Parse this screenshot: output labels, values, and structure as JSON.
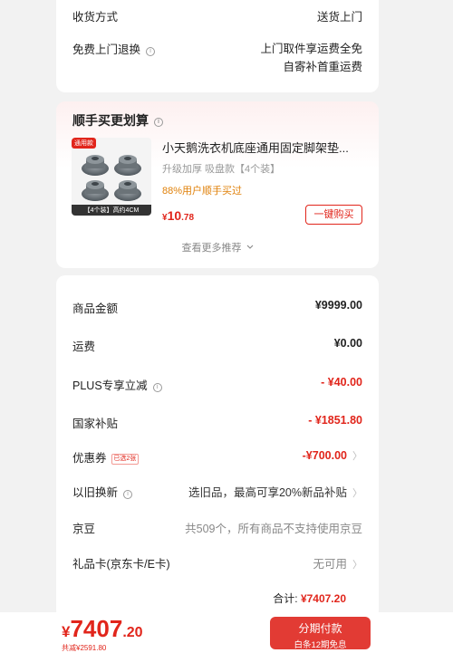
{
  "delivery": {
    "method_label": "收货方式",
    "method_value": "送货上门",
    "return_label": "免费上门退换",
    "return_info_icon": "info-icon",
    "return_value_line1": "上门取件享运费全免",
    "return_value_line2": "自寄补首重运费"
  },
  "recommend": {
    "title": "顺手买更划算",
    "info_icon": "info-icon",
    "product": {
      "badge": "通用款",
      "image_caption": "【4个装】高约4CM",
      "name": "小天鹅洗衣机底座通用固定脚架垫...",
      "spec": "升级加厚 吸盘款【4个装】",
      "buyers": "88%用户顺手买过",
      "price_currency": "¥",
      "price_int": "10",
      "price_dec": ".78",
      "buy_label": "一键购买"
    },
    "more_label": "查看更多推荐",
    "more_icon": "chevron-down-icon"
  },
  "summary": {
    "rows": [
      {
        "label": "商品金额",
        "value": "¥9999.00"
      },
      {
        "label": "运费",
        "value": "¥0.00"
      },
      {
        "label": "PLUS专享立减",
        "value": "- ¥40.00"
      },
      {
        "label": "国家补贴",
        "value": "- ¥1851.80"
      },
      {
        "label": "优惠券",
        "tag": "已选2张",
        "value": "-¥700.00"
      },
      {
        "label": "以旧换新",
        "value": "选旧品，最高可享20%新品补贴"
      },
      {
        "label": "京豆",
        "value": "共509个，所有商品不支持使用京豆"
      },
      {
        "label": "礼品卡(京东卡/E卡)",
        "value": "无可用"
      }
    ],
    "total_label": "合计:",
    "total_value": "¥7407.20"
  },
  "bottom": {
    "price_currency": "¥",
    "price_int": "7407",
    "price_dec": ".20",
    "saved": "共减¥2591.80",
    "pay_label": "分期付款",
    "pay_sub": "白条12期免息"
  },
  "colors": {
    "accent": "#e1251b",
    "buyers_orange": "#e0810a",
    "background": "#f2f2f2"
  }
}
